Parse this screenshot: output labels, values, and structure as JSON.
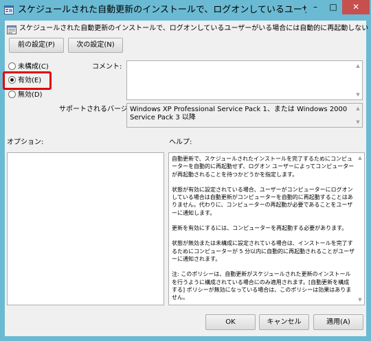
{
  "window": {
    "title": "スケジュールされた自動更新のインストールで、ログオンしているユーザーがいる場合には自動的...",
    "minimize_label": "–",
    "maximize_label": "□",
    "close_label": "✕"
  },
  "policy": {
    "name": "スケジュールされた自動更新のインストールで、ログオンしているユーザーがいる場合には自動的に再起動しない"
  },
  "nav": {
    "prev_label": "前の設定(P)",
    "next_label": "次の設定(N)"
  },
  "state": {
    "options": [
      {
        "label": "未構成(C)",
        "selected": false
      },
      {
        "label": "有効(E)",
        "selected": true
      },
      {
        "label": "無効(D)",
        "selected": false
      }
    ],
    "highlight_color": "#e00000"
  },
  "comment": {
    "label": "コメント:",
    "value": ""
  },
  "supported": {
    "label": "サポートされるバージョン:",
    "value": "Windows XP Professional Service Pack 1、または Windows 2000 Service Pack 3 以降"
  },
  "options_pane": {
    "label": "オプション:"
  },
  "help_pane": {
    "label": "ヘルプ:",
    "paragraphs": [
      "自動更新で、スケジュールされたインストールを完了するためにコンピューターを自動的に再起動せず、ログオン ユーザーによってコンピューターが再起動されることを待つかどうかを指定します。",
      "状態が有効に設定されている場合、ユーザーがコンピューターにログオンしている場合は自動更新がコンピューターを自動的に再起動することはありません。代わりに、コンピューターの再起動が必要であることをユーザーに通知します。",
      "更新を有効にするには、コンピューターを再起動する必要があります。",
      "状態が無効または未構成に設定されている場合は、インストールを完了するためにコンピューターが 5 分以内に自動的に再起動されることがユーザーに通知されます。",
      "注: このポリシーは、自動更新がスケジュールされた更新のインストールを行うように構成されている場合にのみ適用されます。[自動更新を構成する] ポリシーが無効になっている場合は、このポリシーは効果はありません。"
    ]
  },
  "footer": {
    "ok_label": "OK",
    "cancel_label": "キャンセル",
    "apply_label": "適用(A)"
  },
  "colors": {
    "titlebar": "#6bbad3",
    "close_button": "#c7504f",
    "dialog_background": "#f0f0f0"
  },
  "icons": {
    "title": "policy-settings-icon",
    "policy": "policy-settings-icon"
  }
}
